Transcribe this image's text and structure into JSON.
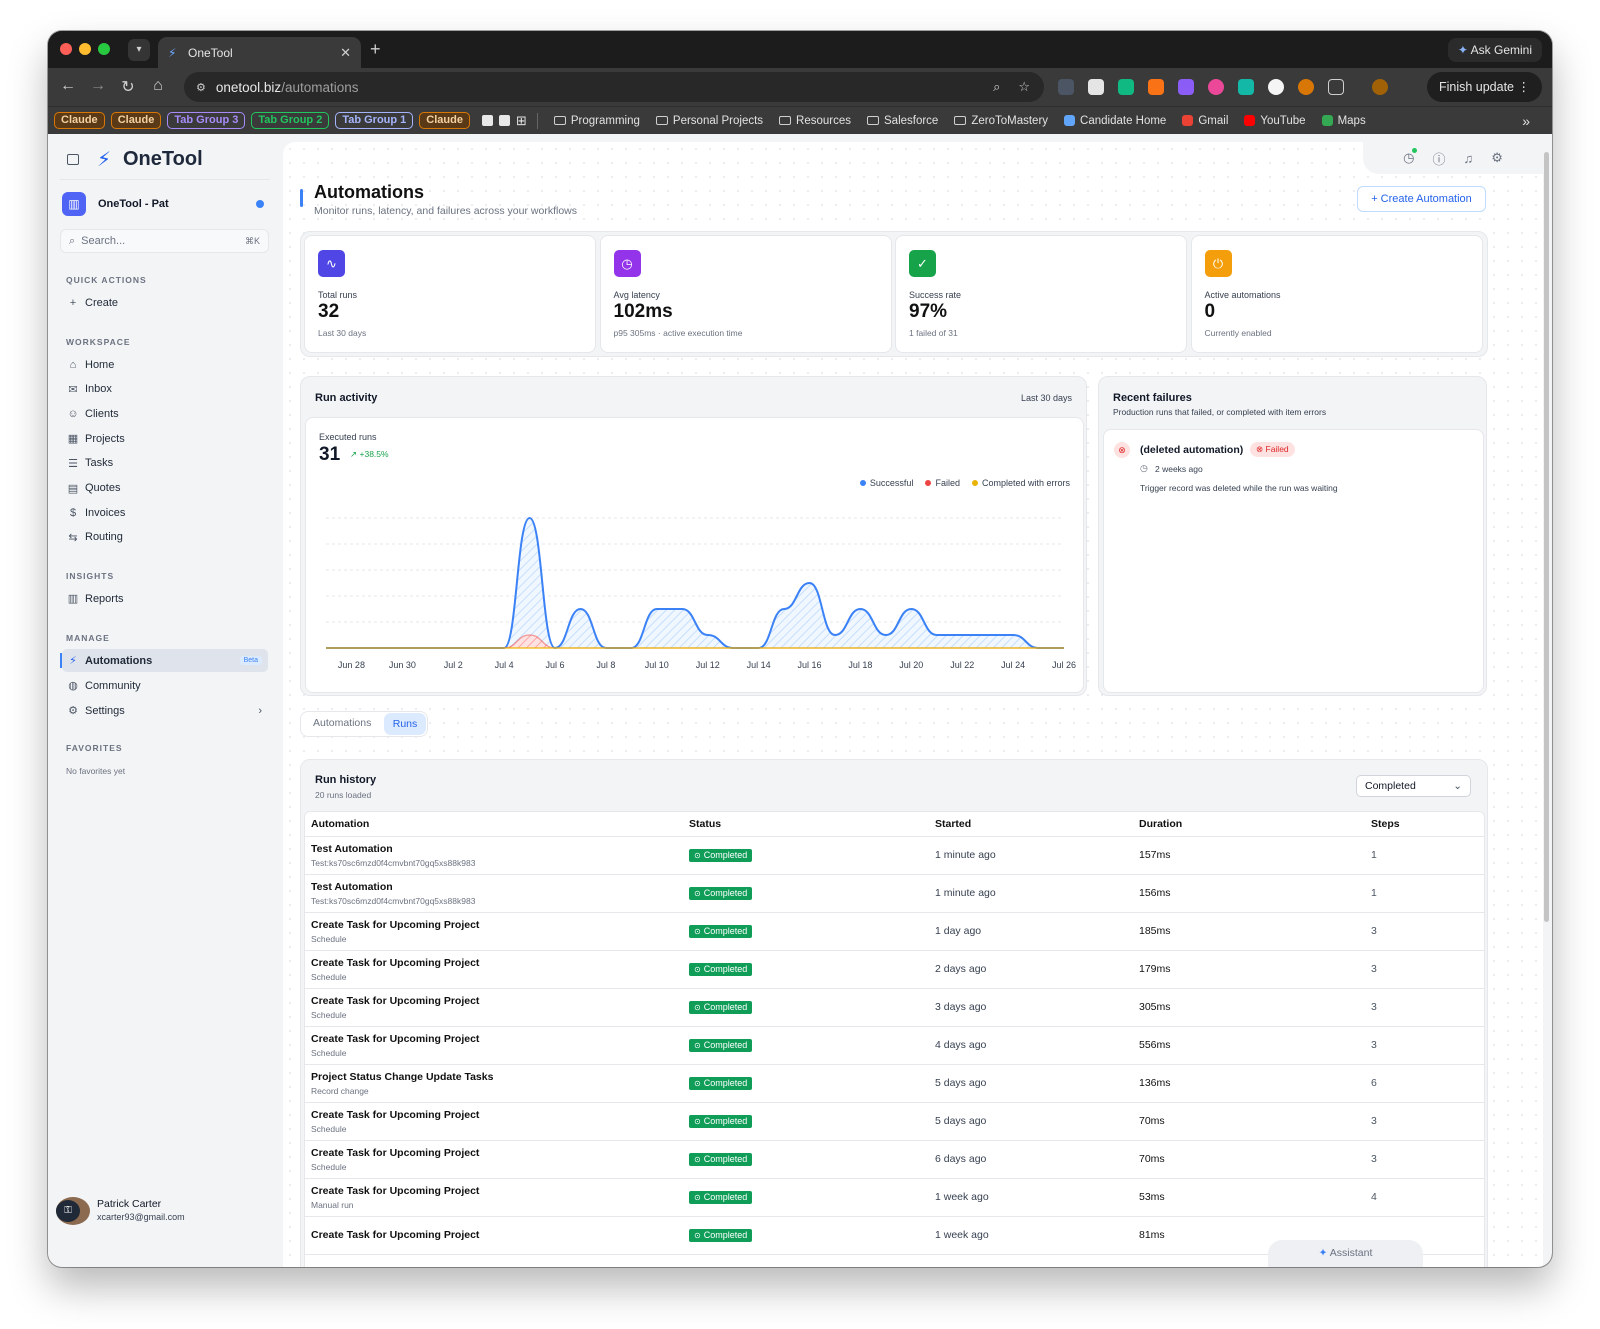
{
  "browser": {
    "tab_title": "OneTool",
    "url_host": "onetool.biz",
    "url_path": "/automations",
    "ask_gemini": "Ask Gemini",
    "finish_update": "Finish update",
    "bookmarks": {
      "tabgroups": [
        {
          "label": "Claude",
          "color": "#d97706"
        },
        {
          "label": "Claude",
          "color": "#d97706"
        },
        {
          "label": "Tab Group 3",
          "color": "#a78bfa"
        },
        {
          "label": "Tab Group 2",
          "color": "#22c55e"
        },
        {
          "label": "Tab Group 1",
          "color": "#a5b4fc"
        },
        {
          "label": "Claude",
          "color": "#d97706"
        }
      ],
      "folders": [
        "Programming",
        "Personal Projects",
        "Resources",
        "Salesforce",
        "ZeroToMastery"
      ],
      "links": [
        {
          "label": "Candidate Home",
          "icon": "candidate-icon",
          "color": "#60a5fa"
        },
        {
          "label": "Gmail",
          "icon": "gmail-icon",
          "color": "#ea4335"
        },
        {
          "label": "YouTube",
          "icon": "youtube-icon",
          "color": "#ff0000"
        },
        {
          "label": "Maps",
          "icon": "maps-icon",
          "color": "#34a853"
        }
      ]
    }
  },
  "sidebar": {
    "brand": "OneTool",
    "workspace": "OneTool - Pat",
    "search_placeholder": "Search...",
    "search_shortcut": "⌘K",
    "quick_actions_label": "QUICK ACTIONS",
    "create": "Create",
    "workspace_label": "WORKSPACE",
    "workspace_items": [
      {
        "label": "Home",
        "icon": "⌂",
        "name": "home"
      },
      {
        "label": "Inbox",
        "icon": "✉",
        "name": "inbox"
      },
      {
        "label": "Clients",
        "icon": "☺",
        "name": "clients"
      },
      {
        "label": "Projects",
        "icon": "▦",
        "name": "projects"
      },
      {
        "label": "Tasks",
        "icon": "☰",
        "name": "tasks"
      },
      {
        "label": "Quotes",
        "icon": "▤",
        "name": "quotes"
      },
      {
        "label": "Invoices",
        "icon": "$",
        "name": "invoices"
      },
      {
        "label": "Routing",
        "icon": "⇆",
        "name": "routing"
      }
    ],
    "insights_label": "INSIGHTS",
    "reports": "Reports",
    "manage_label": "MANAGE",
    "automations": "Automations",
    "automations_badge": "Beta",
    "community": "Community",
    "settings": "Settings",
    "favorites_label": "FAVORITES",
    "no_favorites": "No favorites yet",
    "user_name": "Patrick Carter",
    "user_email": "xcarter93@gmail.com"
  },
  "header": {
    "title": "Automations",
    "subtitle": "Monitor runs, latency, and failures across your workflows",
    "create_button": "+ Create Automation"
  },
  "kpis": [
    {
      "label": "Total runs",
      "value": "32",
      "sub": "Last 30 days",
      "color": "#4f46e5",
      "icon": "activity-icon",
      "glyph": "∿"
    },
    {
      "label": "Avg latency",
      "value": "102ms",
      "sub": "p95 305ms · active execution time",
      "color": "#9333ea",
      "icon": "timer-icon",
      "glyph": "◷"
    },
    {
      "label": "Success rate",
      "value": "97%",
      "sub": "1 failed of 31",
      "color": "#16a34a",
      "icon": "check-circle-icon",
      "glyph": "✓"
    },
    {
      "label": "Active automations",
      "value": "0",
      "sub": "Currently enabled",
      "color": "#f59e0b",
      "icon": "power-icon",
      "glyph": "⏻"
    }
  ],
  "activity": {
    "title": "Run activity",
    "range": "Last 30 days",
    "executed_label": "Executed runs",
    "executed_value": "31",
    "trend": "+38.5%"
  },
  "chart_data": {
    "type": "area",
    "x": [
      "Jun 27",
      "Jun 28",
      "Jun 29",
      "Jun 30",
      "Jul 1",
      "Jul 2",
      "Jul 3",
      "Jul 4",
      "Jul 5",
      "Jul 6",
      "Jul 7",
      "Jul 8",
      "Jul 9",
      "Jul 10",
      "Jul 11",
      "Jul 12",
      "Jul 13",
      "Jul 14",
      "Jul 15",
      "Jul 16",
      "Jul 17",
      "Jul 18",
      "Jul 19",
      "Jul 20",
      "Jul 21",
      "Jul 22",
      "Jul 23",
      "Jul 24",
      "Jul 25",
      "Jul 26"
    ],
    "tick_labels": [
      "Jun 28",
      "Jun 30",
      "Jul 2",
      "Jul 4",
      "Jul 6",
      "Jul 8",
      "Jul 10",
      "Jul 12",
      "Jul 14",
      "Jul 16",
      "Jul 18",
      "Jul 20",
      "Jul 22",
      "Jul 24",
      "Jul 26"
    ],
    "series": [
      {
        "name": "Successful",
        "color": "#3b82f6",
        "values": [
          0,
          0,
          0,
          0,
          0,
          0,
          0,
          0,
          10,
          0,
          3,
          0,
          0,
          3,
          3,
          1,
          0,
          0,
          3,
          5,
          1,
          3,
          1,
          3,
          1,
          1,
          1,
          1,
          0,
          0
        ]
      },
      {
        "name": "Failed",
        "color": "#ef4444",
        "values": [
          0,
          0,
          0,
          0,
          0,
          0,
          0,
          0,
          1,
          0,
          0,
          0,
          0,
          0,
          0,
          0,
          0,
          0,
          0,
          0,
          0,
          0,
          0,
          0,
          0,
          0,
          0,
          0,
          0,
          0
        ]
      },
      {
        "name": "Completed with errors",
        "color": "#eab308",
        "values": [
          0,
          0,
          0,
          0,
          0,
          0,
          0,
          0,
          0,
          0,
          0,
          0,
          0,
          0,
          0,
          0,
          0,
          0,
          0,
          0,
          0,
          0,
          0,
          0,
          0,
          0,
          0,
          0,
          0,
          0
        ]
      }
    ],
    "ylim": [
      0,
      10
    ],
    "grid": true,
    "legend": "top-right"
  },
  "failures": {
    "title": "Recent failures",
    "subtitle": "Production runs that failed, or completed with item errors",
    "item_name": "(deleted automation)",
    "item_status": "Failed",
    "item_time": "2 weeks ago",
    "item_message": "Trigger record was deleted while the run was waiting"
  },
  "tabs": {
    "automations": "Automations",
    "runs": "Runs"
  },
  "history": {
    "title": "Run history",
    "subtitle": "20 runs loaded",
    "filter": "Completed",
    "columns": [
      "Automation",
      "Status",
      "Started",
      "Duration",
      "Steps"
    ],
    "rows": [
      {
        "name": "Test Automation",
        "trigger": "Test:ks70sc6mzd0f4cmvbnt70gq5xs88k983",
        "status": "Completed",
        "started": "1 minute ago",
        "duration": "157ms",
        "steps": "1"
      },
      {
        "name": "Test Automation",
        "trigger": "Test:ks70sc6mzd0f4cmvbnt70gq5xs88k983",
        "status": "Completed",
        "started": "1 minute ago",
        "duration": "156ms",
        "steps": "1"
      },
      {
        "name": "Create Task for Upcoming Project",
        "trigger": "Schedule",
        "status": "Completed",
        "started": "1 day ago",
        "duration": "185ms",
        "steps": "3"
      },
      {
        "name": "Create Task for Upcoming Project",
        "trigger": "Schedule",
        "status": "Completed",
        "started": "2 days ago",
        "duration": "179ms",
        "steps": "3"
      },
      {
        "name": "Create Task for Upcoming Project",
        "trigger": "Schedule",
        "status": "Completed",
        "started": "3 days ago",
        "duration": "305ms",
        "steps": "3"
      },
      {
        "name": "Create Task for Upcoming Project",
        "trigger": "Schedule",
        "status": "Completed",
        "started": "4 days ago",
        "duration": "556ms",
        "steps": "3"
      },
      {
        "name": "Project Status Change Update Tasks",
        "trigger": "Record change",
        "status": "Completed",
        "started": "5 days ago",
        "duration": "136ms",
        "steps": "6"
      },
      {
        "name": "Create Task for Upcoming Project",
        "trigger": "Schedule",
        "status": "Completed",
        "started": "5 days ago",
        "duration": "70ms",
        "steps": "3"
      },
      {
        "name": "Create Task for Upcoming Project",
        "trigger": "Schedule",
        "status": "Completed",
        "started": "6 days ago",
        "duration": "70ms",
        "steps": "3"
      },
      {
        "name": "Create Task for Upcoming Project",
        "trigger": "Manual run",
        "status": "Completed",
        "started": "1 week ago",
        "duration": "53ms",
        "steps": "4"
      },
      {
        "name": "Create Task for Upcoming Project",
        "trigger": "",
        "status": "Completed",
        "started": "1 week ago",
        "duration": "81ms",
        "steps": ""
      }
    ]
  },
  "assistant": "Assistant"
}
